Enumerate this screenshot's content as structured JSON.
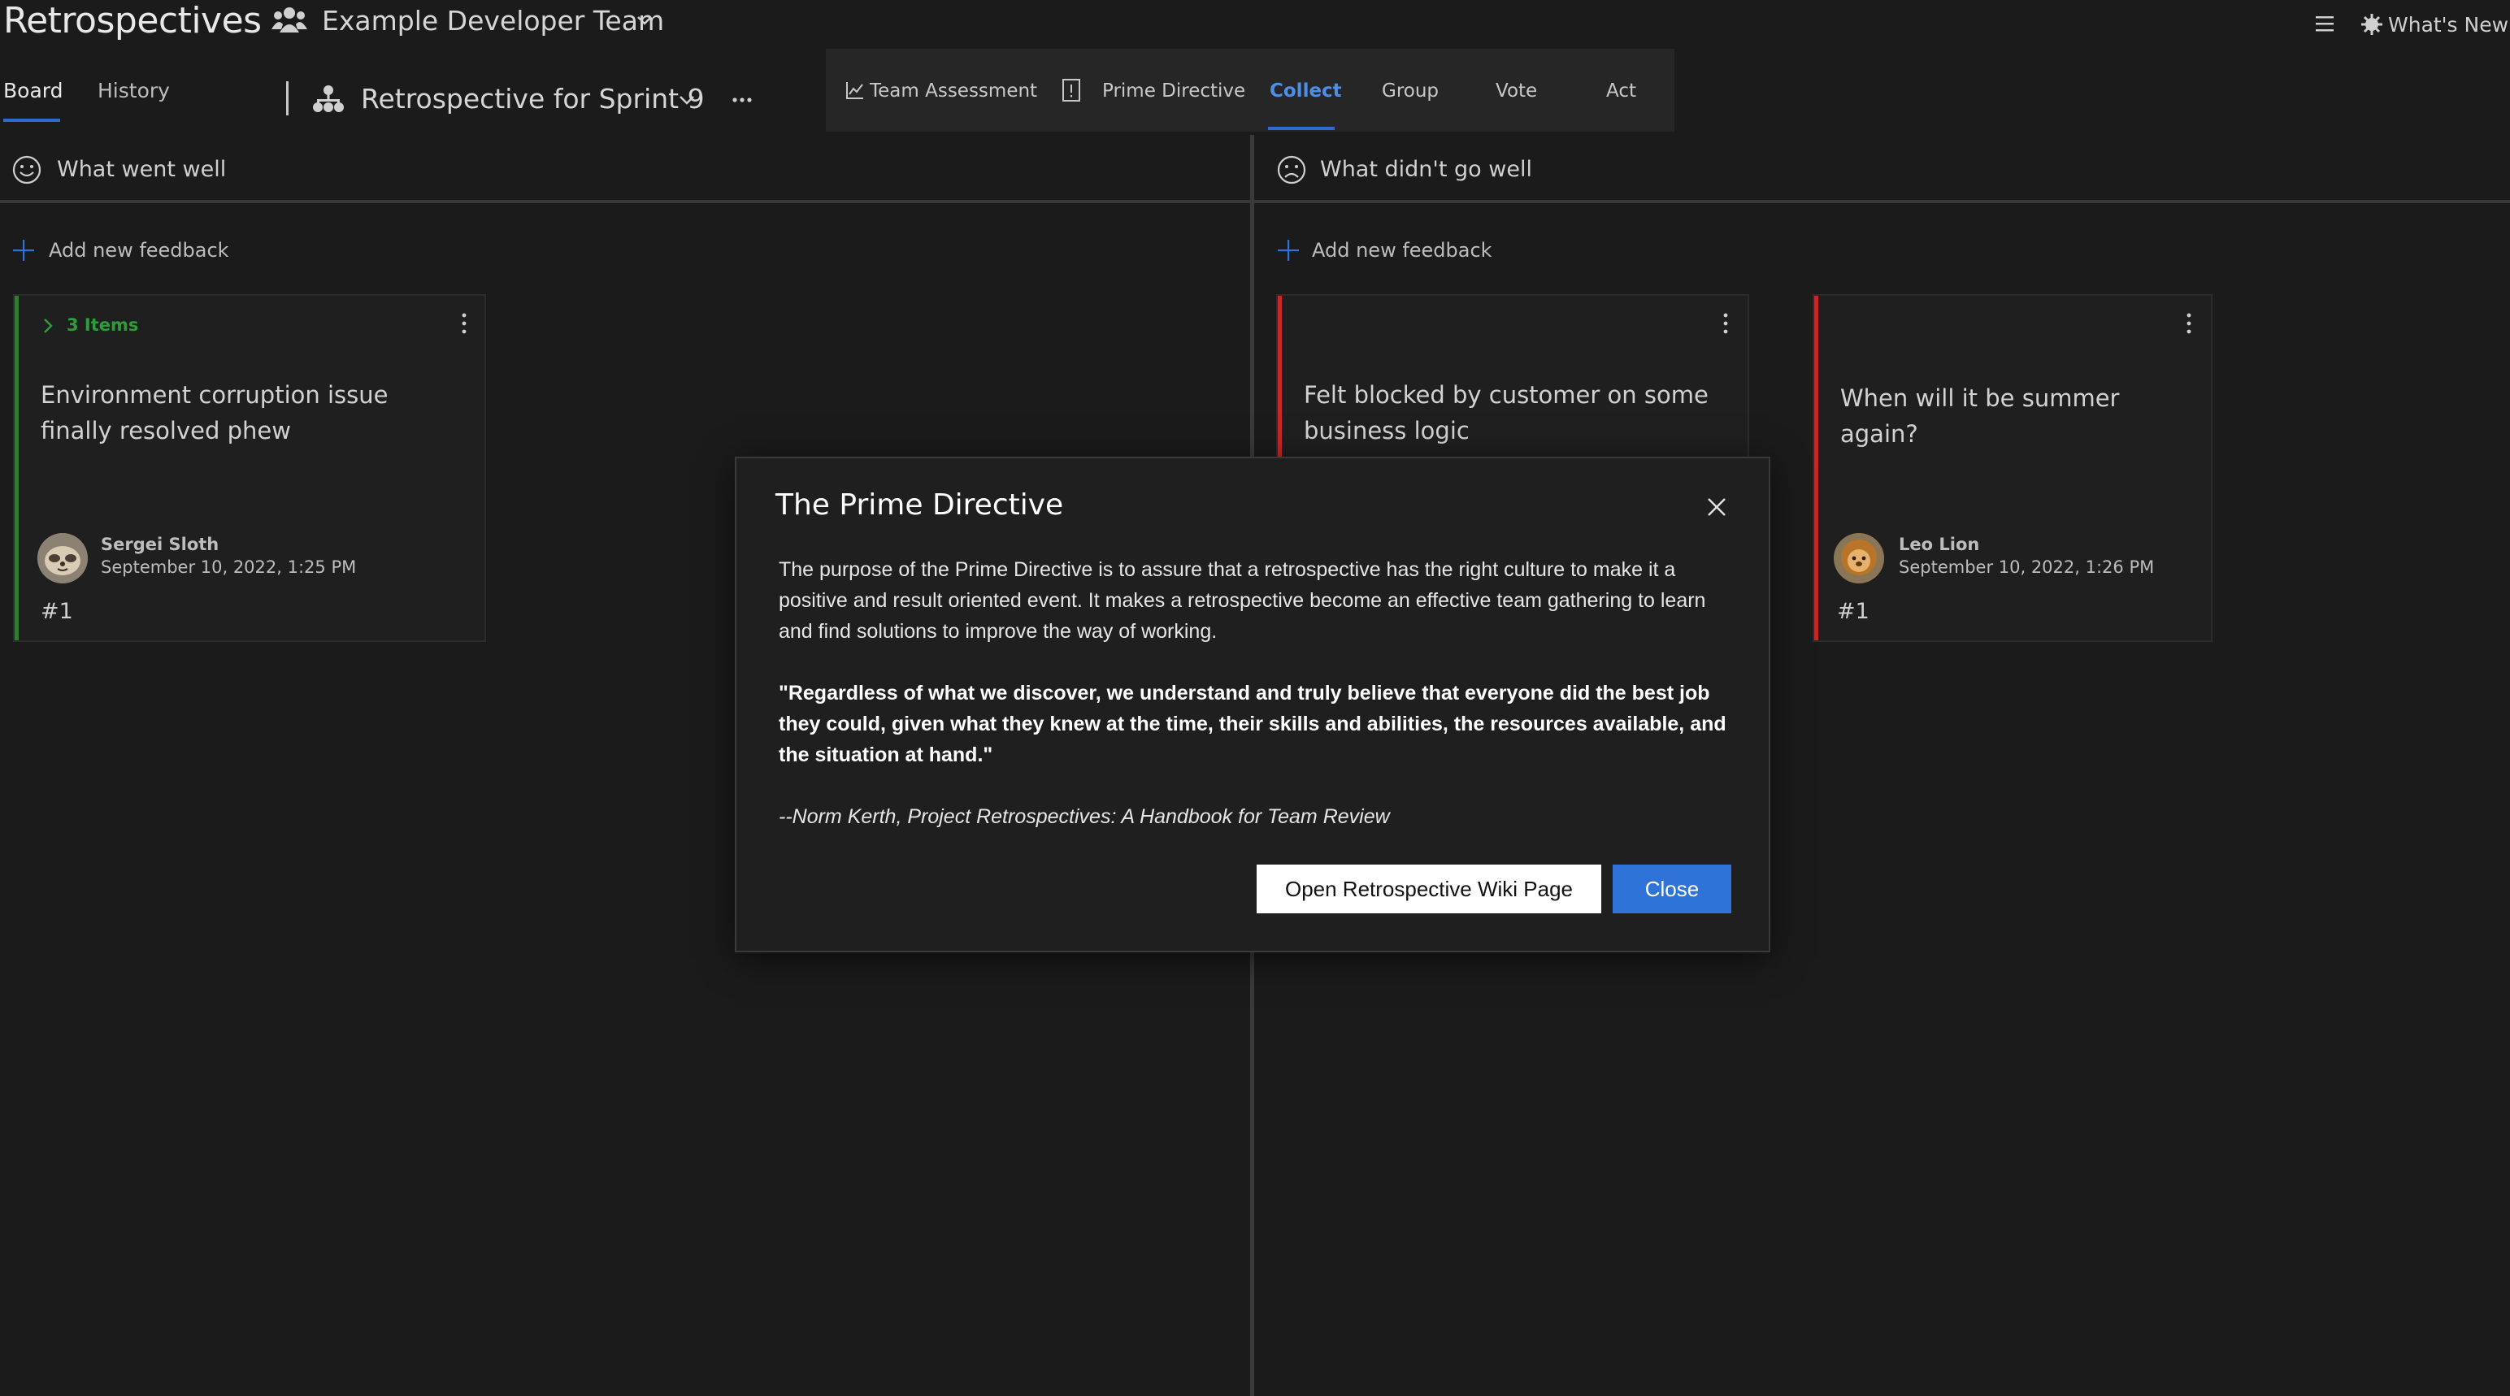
{
  "header": {
    "app_title": "Retrospectives",
    "team_name": "Example Developer Team",
    "whats_new": "What's New"
  },
  "tabs": {
    "board": "Board",
    "history": "History"
  },
  "retro": {
    "title": "Retrospective for Sprint 9"
  },
  "phases": [
    {
      "label": "Team Assessment",
      "icon": "chart-line-icon"
    },
    {
      "label": "Prime Directive",
      "icon": "info-doc-icon"
    },
    {
      "label": "Collect",
      "active": true
    },
    {
      "label": "Group"
    },
    {
      "label": "Vote"
    },
    {
      "label": "Act"
    }
  ],
  "columns": [
    {
      "title": "What went well",
      "icon": "smiley-icon",
      "add_feedback": "Add new feedback",
      "accent": "#2e7d32",
      "cards": [
        {
          "group_label": "3 Items",
          "text": "Environment corruption issue finally resolved phew",
          "author": "Sergei Sloth",
          "date": "September 10, 2022, 1:25 PM",
          "number": "#1"
        }
      ]
    },
    {
      "title": "What didn't go well",
      "icon": "frown-icon",
      "add_feedback": "Add new feedback",
      "accent": "#c62828",
      "cards": [
        {
          "text": "Felt blocked by customer on some business logic"
        },
        {
          "text": "When will it be summer again?",
          "author": "Leo Lion",
          "date": "September 10, 2022, 1:26 PM",
          "number": "#1"
        }
      ]
    }
  ],
  "modal": {
    "title": "The Prime Directive",
    "paragraph": "The purpose of the Prime Directive is to assure that a retrospective has the right culture to make it a positive and result oriented event. It makes a retrospective become an effective team gathering to learn and find solutions to improve the way of working.",
    "quote": "\"Regardless of what we discover, we understand and truly believe that everyone did the best job they could, given what they knew at the time, their skills and abilities, the resources available, and the situation at hand.\"",
    "citation": "--Norm Kerth, Project Retrospectives: A Handbook for Team Review",
    "wiki_button": "Open Retrospective Wiki Page",
    "close_button": "Close"
  },
  "colors": {
    "background": "#1b1b1b",
    "accent_blue": "#2f73d8",
    "went_well": "#2e7d32",
    "didnt_go_well": "#c62828"
  }
}
